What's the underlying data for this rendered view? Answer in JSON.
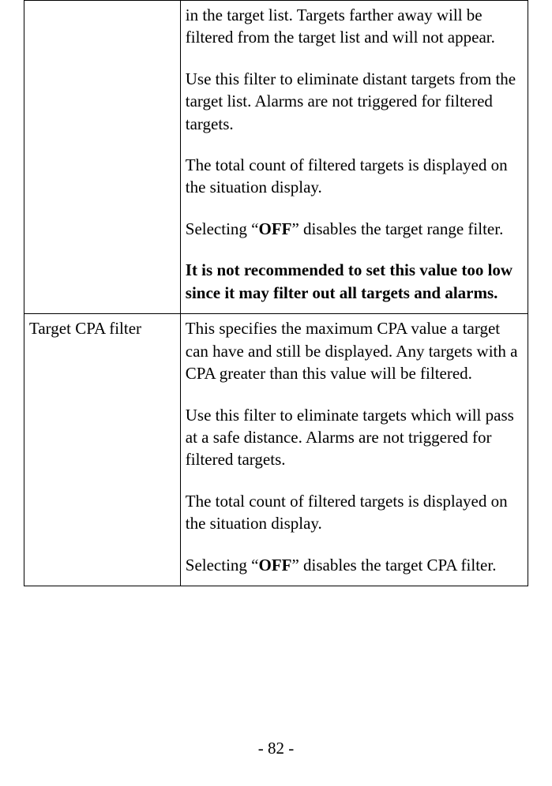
{
  "table": {
    "row1": {
      "label": "",
      "p1": "in the target list. Targets farther away will be filtered from the target list and will not appear.",
      "p2": "Use this filter to eliminate distant targets from the target list. Alarms are not triggered for filtered targets.",
      "p3": "The total count of filtered targets is displayed on the situation display.",
      "p4a": "Selecting “",
      "p4b": "OFF",
      "p4c": "” disables the target range filter.",
      "p5": "It is not recommended to set this value too low since it may filter out all targets and alarms."
    },
    "row2": {
      "label": "Target CPA filter",
      "p1": "This specifies the maximum CPA value a target can have and still be displayed. Any targets with a CPA greater than this value will be filtered.",
      "p2": "Use this filter to eliminate targets which will pass at a safe distance. Alarms are not triggered for filtered targets.",
      "p3": "The total count of filtered targets is displayed on the situation display.",
      "p4a": "Selecting “",
      "p4b": "OFF",
      "p4c": "” disables the target CPA filter."
    }
  },
  "footer": {
    "page": "- 82 -"
  }
}
